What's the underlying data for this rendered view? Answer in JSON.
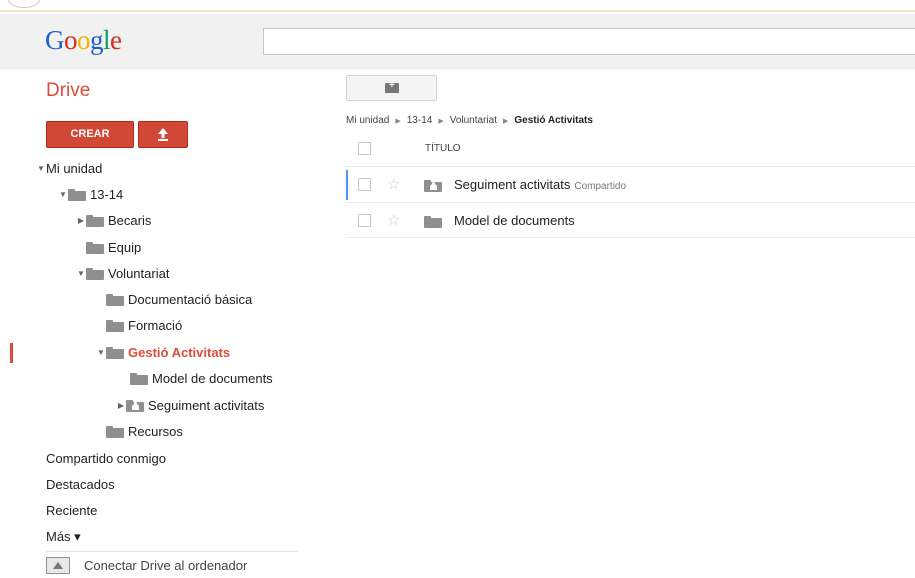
{
  "header": {
    "logo_text": "Google",
    "search_placeholder": ""
  },
  "sidebar": {
    "drive_title": "Drive",
    "create_label": "CREAR",
    "tree": [
      {
        "label": "Mi unidad",
        "expanded": true
      },
      {
        "label": "13-14",
        "expanded": true
      },
      {
        "label": "Becaris",
        "expanded": false
      },
      {
        "label": "Equip"
      },
      {
        "label": "Voluntariat",
        "expanded": true
      },
      {
        "label": "Documentació básica"
      },
      {
        "label": "Formació"
      },
      {
        "label": "Gestió Activitats",
        "expanded": true,
        "active": true
      },
      {
        "label": "Model de documents"
      },
      {
        "label": "Seguiment activitats",
        "expanded": false,
        "shared": true
      },
      {
        "label": "Recursos"
      }
    ],
    "links": {
      "shared": "Compartido conmigo",
      "starred": "Destacados",
      "recent": "Reciente",
      "more": "Más ▾"
    },
    "connect_label": "Conectar Drive al ordenador"
  },
  "main": {
    "breadcrumb": [
      "Mi unidad",
      "13-14",
      "Voluntariat",
      "Gestió Activitats"
    ],
    "column_title": "TÍTULO",
    "rows": [
      {
        "name": "Seguiment activitats",
        "tag": "Compartido",
        "shared": true
      },
      {
        "name": "Model de documents",
        "tag": "",
        "shared": false
      }
    ]
  },
  "colors": {
    "accent_red": "#dd4b39",
    "button_red": "#d14836",
    "selection_blue": "#4d90fe"
  }
}
